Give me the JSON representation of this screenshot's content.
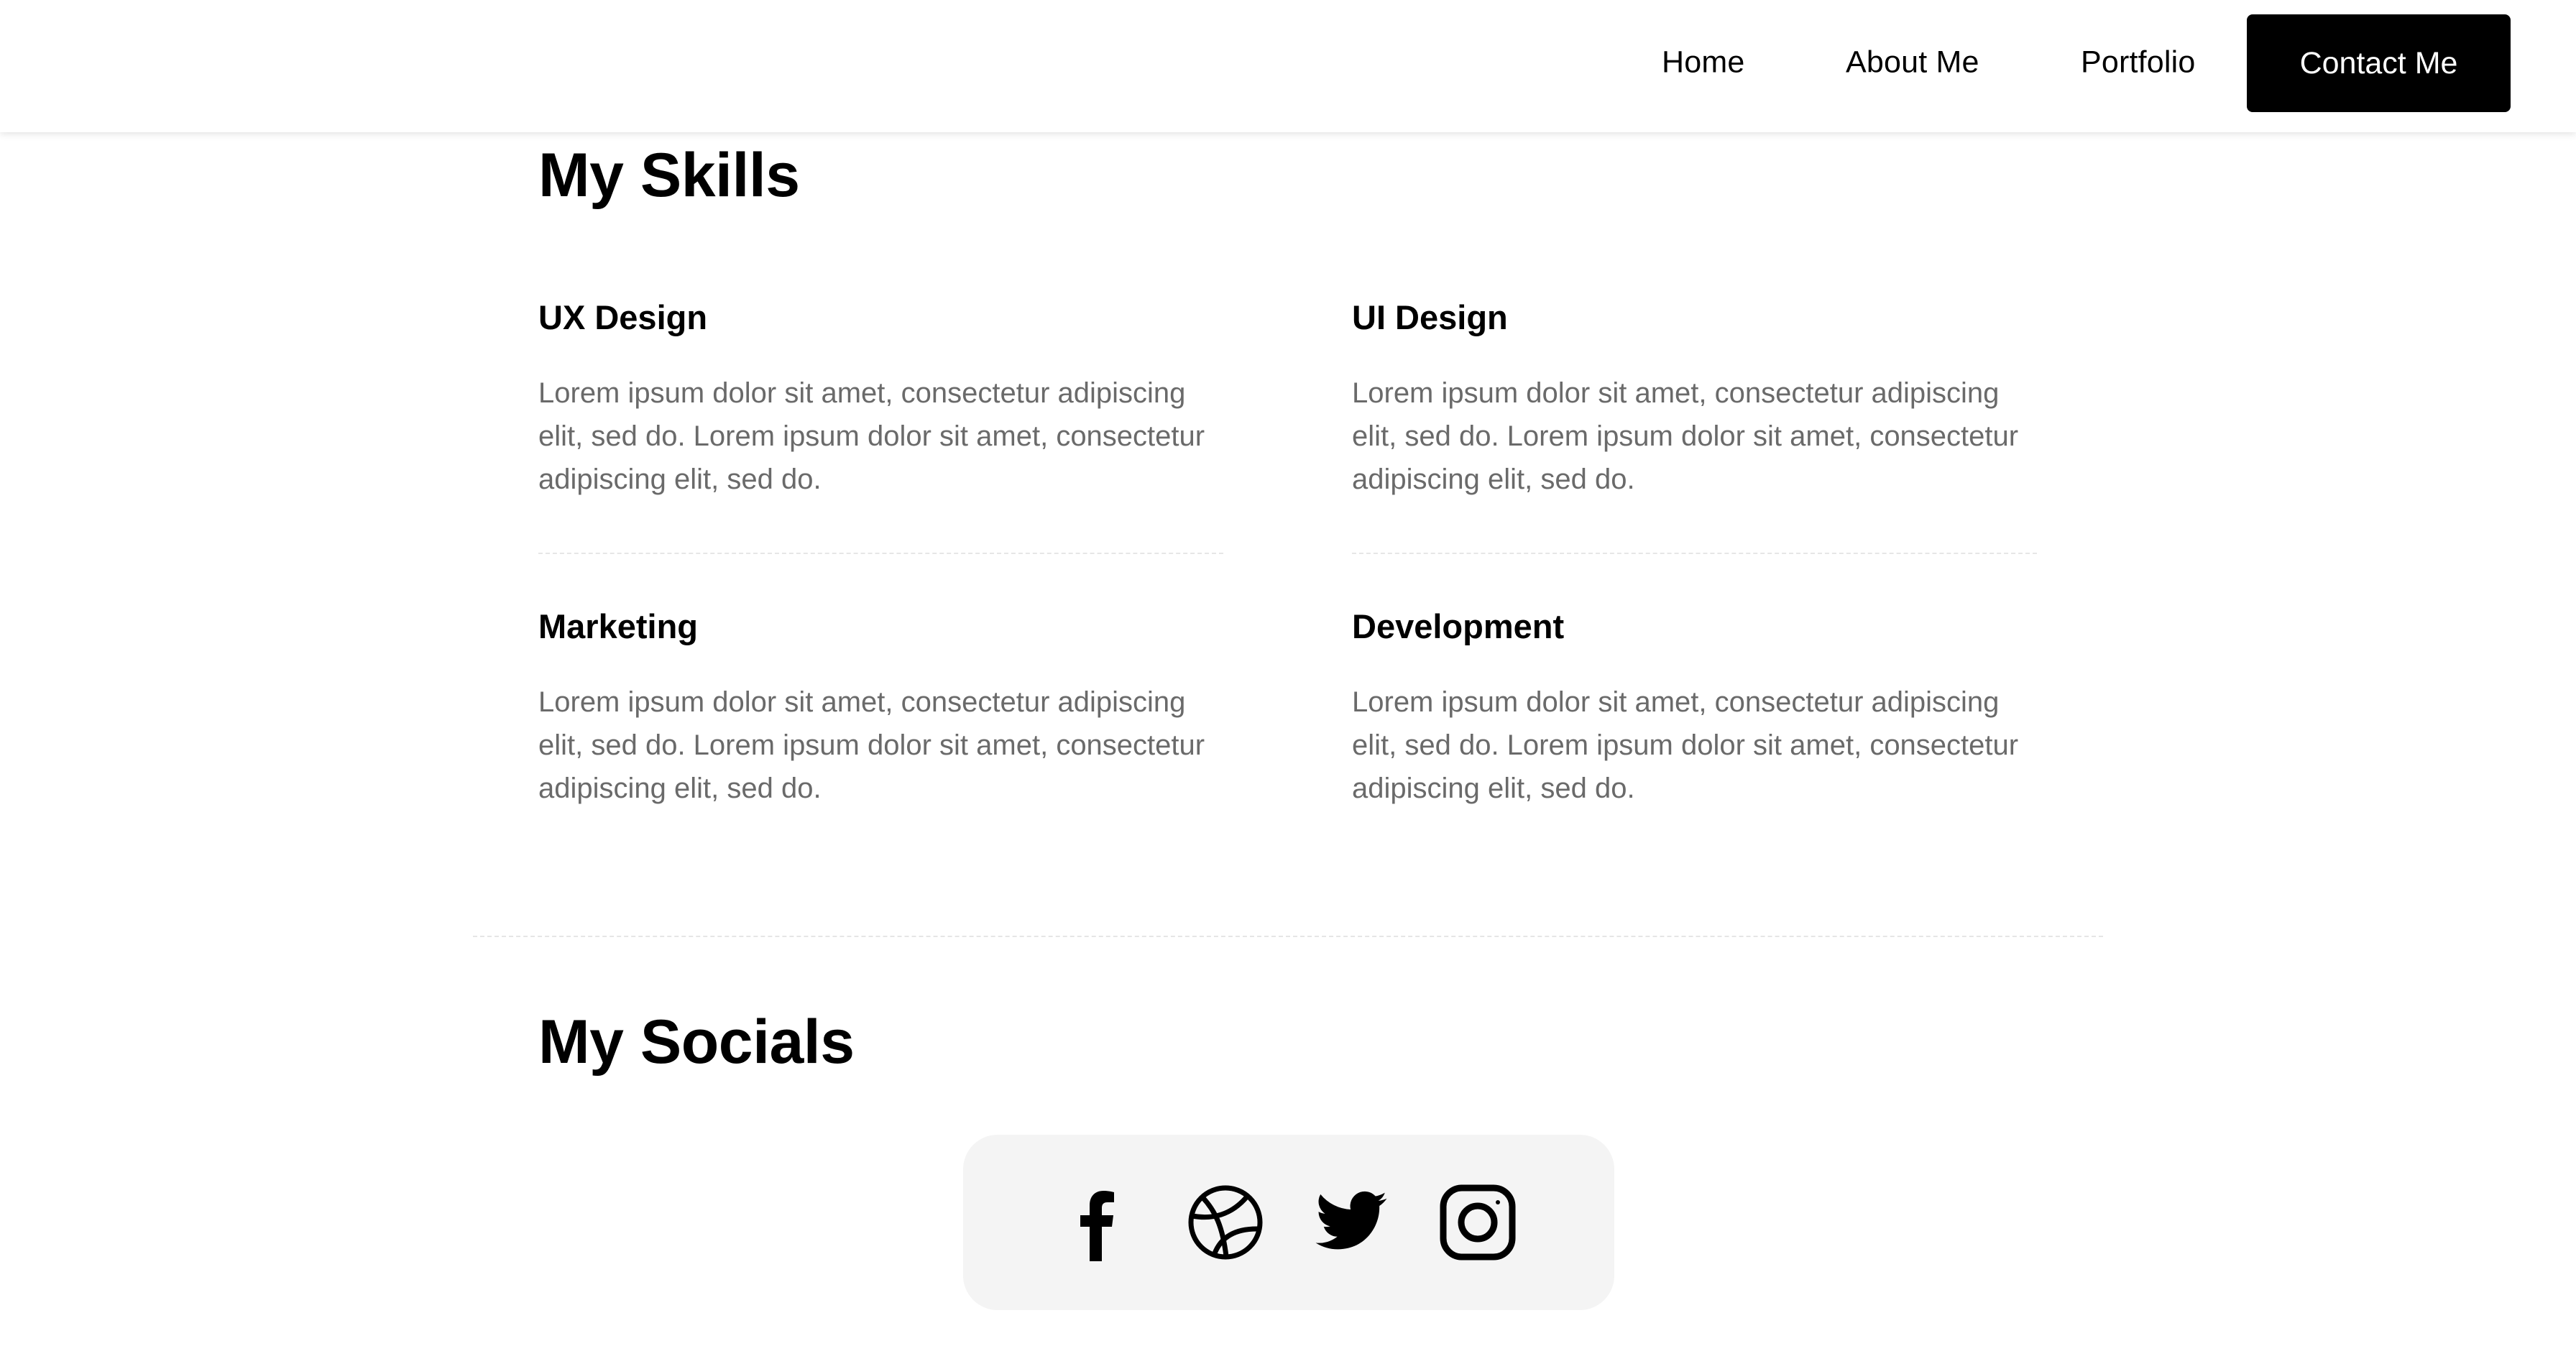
{
  "nav": {
    "home": "Home",
    "about": "About Me",
    "portfolio": "Portfolio",
    "contact": "Contact Me"
  },
  "skills": {
    "title": "My Skills",
    "items": [
      {
        "title": "UX Design",
        "text": "Lorem ipsum dolor sit amet, consectetur adipiscing elit, sed do. Lorem ipsum dolor sit amet, consectetur adipiscing elit, sed do."
      },
      {
        "title": "UI Design",
        "text": "Lorem ipsum dolor sit amet, consectetur adipiscing elit, sed do. Lorem ipsum dolor sit amet, consectetur adipiscing elit, sed do."
      },
      {
        "title": "Marketing",
        "text": "Lorem ipsum dolor sit amet, consectetur adipiscing elit, sed do. Lorem ipsum dolor sit amet, consectetur adipiscing elit, sed do."
      },
      {
        "title": "Development",
        "text": "Lorem ipsum dolor sit amet, consectetur adipiscing elit, sed do. Lorem ipsum dolor sit amet, consectetur adipiscing elit, sed do."
      }
    ]
  },
  "socials": {
    "title": "My Socials",
    "icons": [
      "facebook-icon",
      "dribbble-icon",
      "twitter-icon",
      "instagram-icon"
    ]
  },
  "colors": {
    "accent": "#000000",
    "body_text": "#6a6a6a",
    "social_background": "#f4f4f4",
    "divider": "#e6e6e6"
  }
}
